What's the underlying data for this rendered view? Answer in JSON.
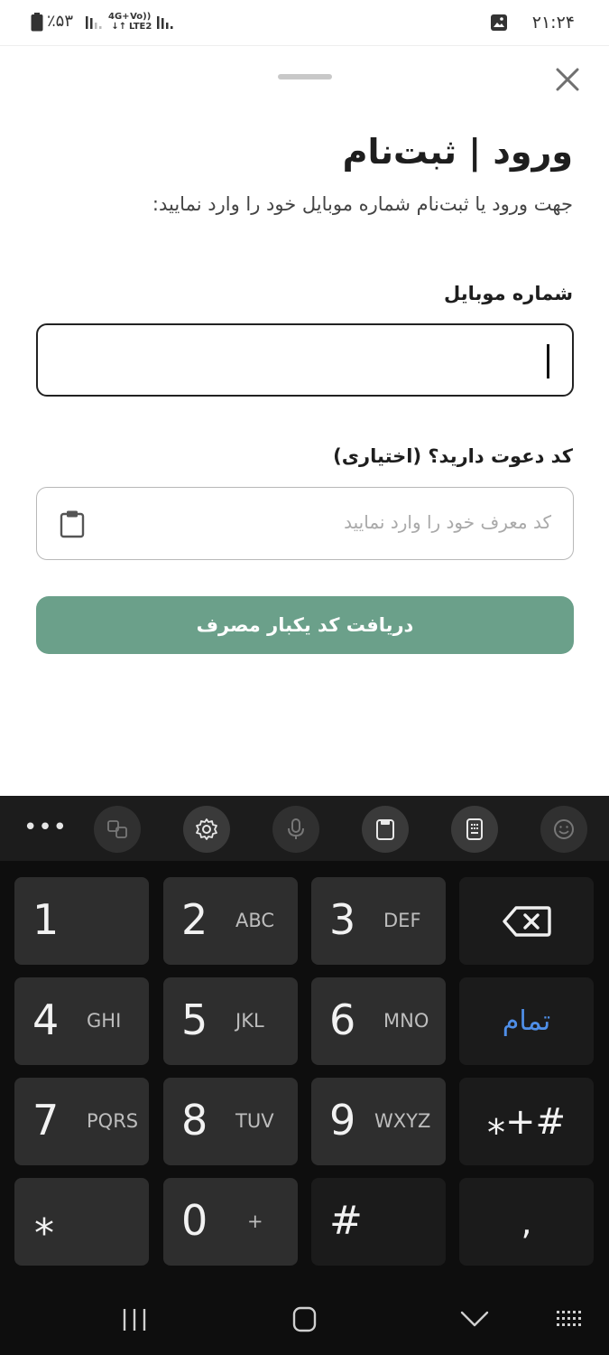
{
  "status_bar": {
    "time": "۲۱:۲۴",
    "battery_percent": "٪۵۳",
    "network_type": "4G+",
    "network_arrows": "↓↑",
    "volte_top": "Vo))",
    "volte_bottom": "LTE2"
  },
  "sheet": {
    "title": "ورود | ثبت‌نام",
    "subtitle": "جهت ورود یا ثبت‌نام شماره موبایل خود را وارد نمایید:",
    "mobile_label": "شماره موبایل",
    "mobile_value": "",
    "invite_label": "کد دعوت دارید؟ (اختیاری)",
    "invite_placeholder": "کد معرف خود را وارد نمایید",
    "submit_label": "دریافت کد یکبار مصرف",
    "accent_color": "#6ba08a"
  },
  "keyboard": {
    "toolbar": {
      "more": "•••",
      "icons": [
        "translate-icon",
        "settings-icon",
        "microphone-icon",
        "clipboard-icon",
        "keyboard-mode-icon",
        "emoji-icon"
      ]
    },
    "keys": [
      {
        "num": "1",
        "sub": ""
      },
      {
        "num": "2",
        "sub": "ABC"
      },
      {
        "num": "3",
        "sub": "DEF"
      },
      {
        "num": "4",
        "sub": "GHI"
      },
      {
        "num": "5",
        "sub": "JKL"
      },
      {
        "num": "6",
        "sub": "MNO"
      },
      {
        "num": "7",
        "sub": "PQRS"
      },
      {
        "num": "8",
        "sub": "TUV"
      },
      {
        "num": "9",
        "sub": "WXYZ"
      },
      {
        "num": "0",
        "sub": "+"
      }
    ],
    "done_label": "تمام",
    "symbols_label": "⁎+#",
    "star_label": "⁎",
    "hash_label": "#",
    "comma_label": ",",
    "done_color": "#4f8fe8"
  },
  "nav_bar": {
    "icons": [
      "recents-icon",
      "home-icon",
      "back-icon",
      "keyboard-switch-icon"
    ]
  }
}
